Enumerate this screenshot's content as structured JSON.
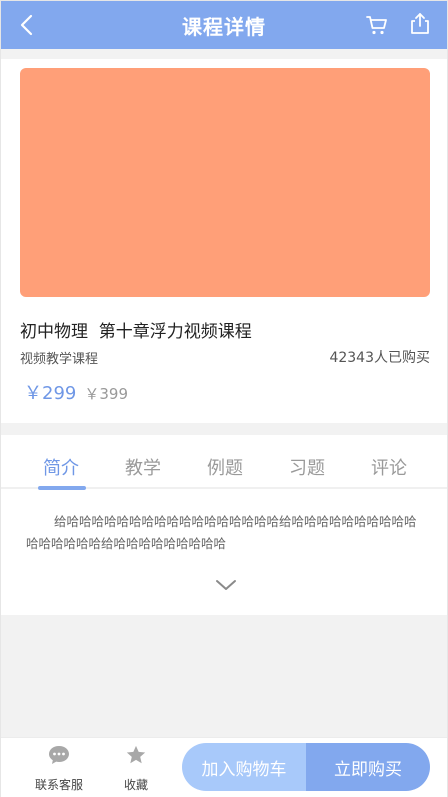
{
  "header": {
    "title": "课程详情",
    "back_icon": "chevron-left-icon",
    "cart_icon": "cart-icon",
    "share_icon": "share-icon"
  },
  "product": {
    "cover_color": "#ff9f78",
    "title": "初中物理  第十章浮力视频课程",
    "subtitle": "视频教学课程",
    "buyers": "42343人已购买",
    "price_now": "￥299",
    "price_old": "￥399"
  },
  "tabs": {
    "items": [
      "简介",
      "教学",
      "例题",
      "习题",
      "评论"
    ],
    "active_index": 0
  },
  "intro": {
    "text": "给哈哈哈哈哈哈哈哈哈哈哈哈哈哈哈哈哈给哈哈哈哈哈哈哈哈哈哈哈哈哈哈哈哈给哈哈哈哈哈哈哈哈哈",
    "expand_icon": "chevron-down-icon"
  },
  "bottom_bar": {
    "service_label": "联系客服",
    "favorite_label": "收藏",
    "add_cart_label": "加入购物车",
    "buy_label": "立即购买"
  },
  "colors": {
    "accent": "#82a8ee",
    "accent_light": "#a8c9fa",
    "price": "#6f97e6"
  }
}
